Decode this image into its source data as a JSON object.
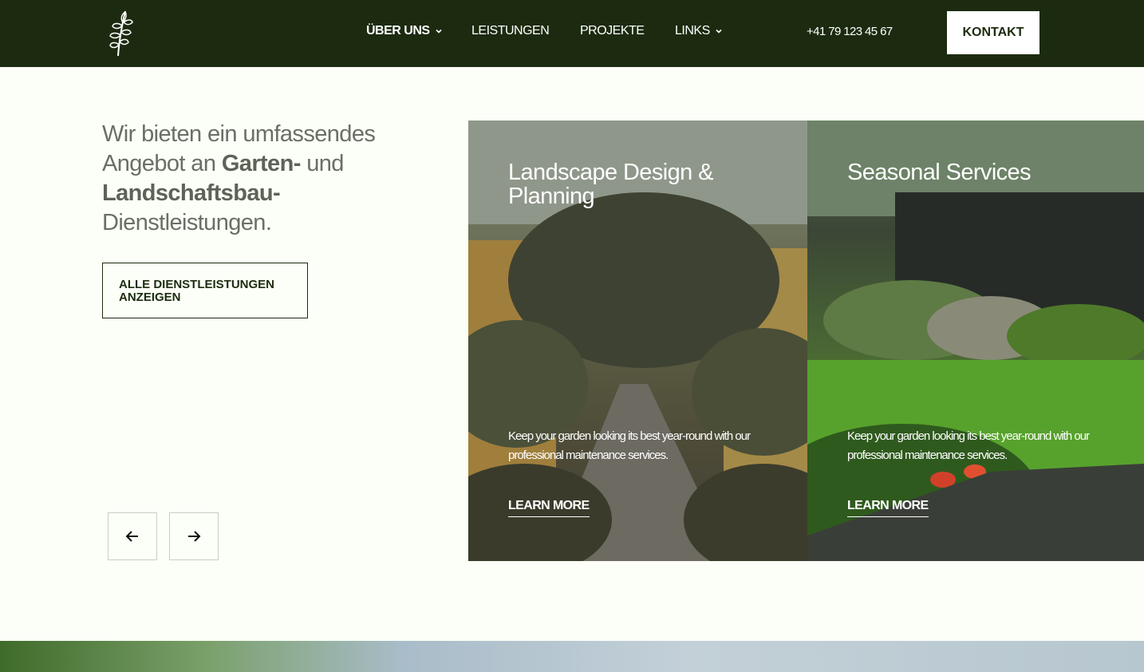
{
  "header": {
    "nav": [
      {
        "label": "ÜBER UNS",
        "dropdown": true
      },
      {
        "label": "LEISTUNGEN",
        "dropdown": false
      },
      {
        "label": "PROJEKTE",
        "dropdown": false
      },
      {
        "label": "LINKS",
        "dropdown": true
      }
    ],
    "phone": "+41 79 123 45 67",
    "cta_label": "KONTAKT"
  },
  "intro": {
    "text_1": "Wir bieten ein umfassendes Angebot an ",
    "bold_1": "Garten-",
    "text_2": " und ",
    "bold_2": "Landschaftsbau-",
    "text_3": " Dienstleistungen.",
    "button_label": "ALLE DIENSTLEISTUNGEN ANZEIGEN"
  },
  "cards": [
    {
      "title": "Landscape Design & Planning",
      "description": "Keep your garden looking its best year-round with our professional maintenance services.",
      "link_label": "LEARN MORE"
    },
    {
      "title": "Seasonal Services",
      "description": "Keep your garden looking its best year-round with our professional maintenance services.",
      "link_label": "LEARN MORE"
    }
  ],
  "icons": {
    "logo": "leaf-branch-icon",
    "dropdown": "chevron-down-icon",
    "prev": "arrow-left-icon",
    "next": "arrow-right-icon"
  },
  "colors": {
    "header_bg": "#1c2b10",
    "page_bg": "#fbfff7",
    "text_muted": "#6b6e64"
  }
}
